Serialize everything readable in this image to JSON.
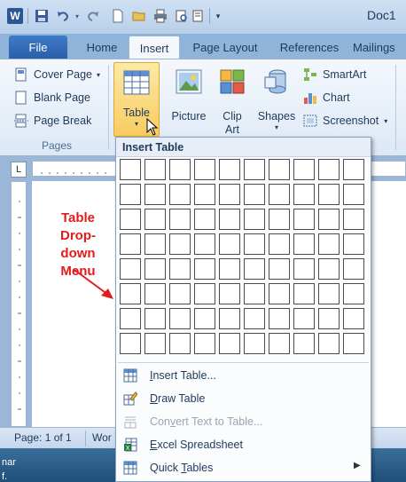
{
  "window": {
    "title": "Doc1",
    "app_icon_letter": "W"
  },
  "tabs": {
    "file": "File",
    "items": [
      "Home",
      "Insert",
      "Page Layout",
      "References",
      "Mailings"
    ]
  },
  "ribbon": {
    "pages": {
      "cover_page": "Cover Page",
      "blank_page": "Blank Page",
      "page_break": "Page Break",
      "label": "Pages"
    },
    "table": {
      "label": "Table"
    },
    "illustrations": {
      "picture": "Picture",
      "clip": "Clip",
      "art": "Art",
      "shapes": "Shapes",
      "smartart": "SmartArt",
      "chart": "Chart",
      "screenshot": "Screenshot"
    }
  },
  "annotation": {
    "line1": "Table",
    "line2": "Drop-down",
    "line3": "Menu"
  },
  "dropdown": {
    "header": "Insert Table",
    "grid": {
      "rows": 8,
      "cols": 10
    },
    "items": {
      "insert_table": {
        "u": "I",
        "rest": "nsert Table..."
      },
      "draw_table": {
        "u": "D",
        "rest": "raw Table"
      },
      "convert_text": {
        "pre": "Con",
        "u": "v",
        "rest": "ert Text to Table..."
      },
      "excel": {
        "u": "E",
        "rest": "xcel Spreadsheet"
      },
      "quick_tables": {
        "pre": "Quick ",
        "u": "T",
        "rest": "ables"
      }
    }
  },
  "statusbar": {
    "page": "Page: 1 of 1",
    "words": "Wor"
  },
  "taskbar": {
    "text1": "nar",
    "text2": "f."
  },
  "colors": {
    "accent": "#2a5ea8",
    "annotation": "#e41b1b",
    "ribbon_bg": "#f4f8fd"
  }
}
